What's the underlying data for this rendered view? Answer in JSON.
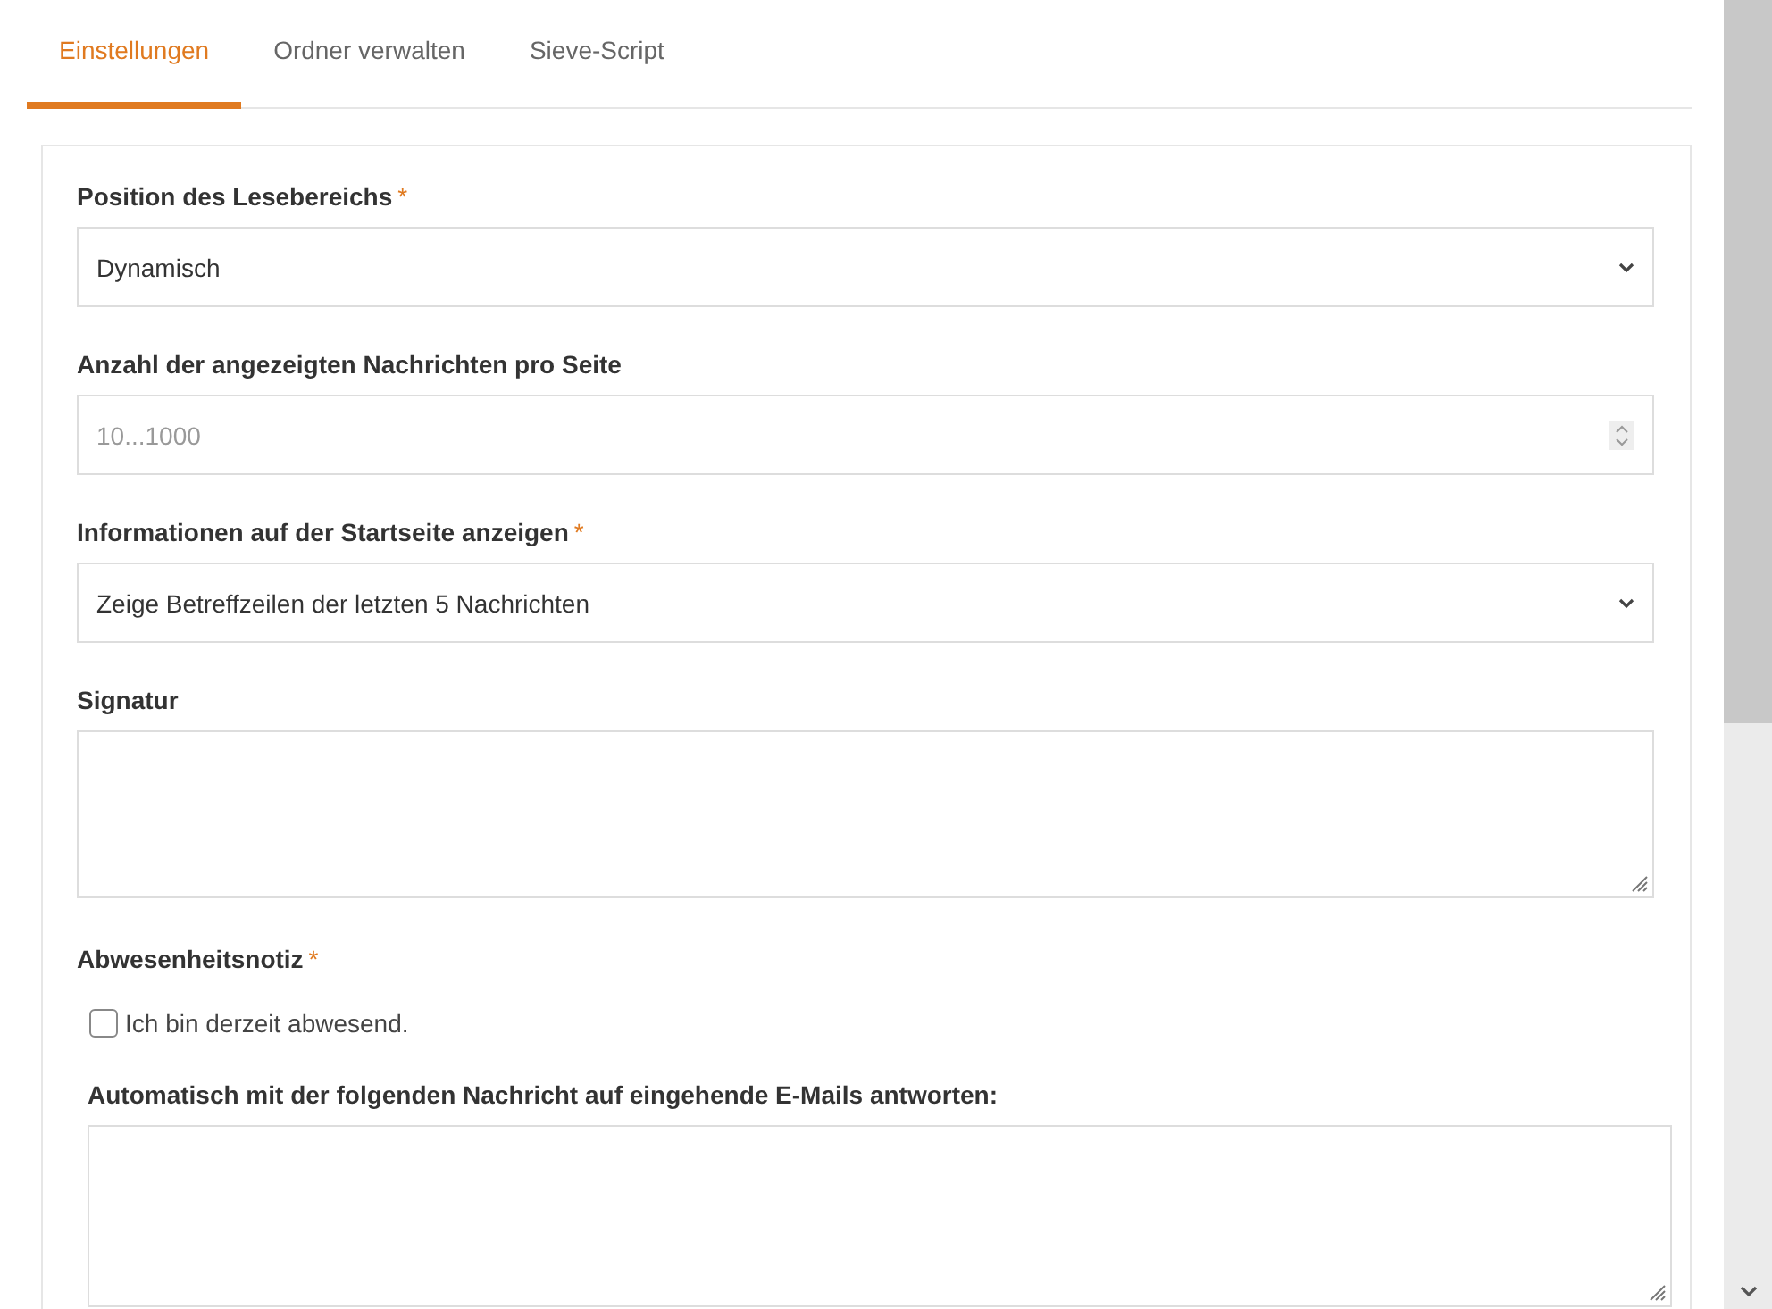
{
  "tabs": [
    {
      "label": "Einstellungen",
      "selected": true
    },
    {
      "label": "Ordner verwalten",
      "selected": false
    },
    {
      "label": "Sieve-Script",
      "selected": false
    }
  ],
  "fields": [
    {
      "kind": "select",
      "label": "Position des Lesebereichs",
      "required": true,
      "value": "Dynamisch"
    },
    {
      "kind": "number",
      "label": "Anzahl der angezeigten Nachrichten pro Seite",
      "required": false,
      "placeholder": "10...1000"
    },
    {
      "kind": "select",
      "label": "Informationen auf der Startseite anzeigen",
      "required": true,
      "value": "Zeige Betreffzeilen der letzten 5 Nachrichten"
    },
    {
      "kind": "textarea",
      "label": "Signatur",
      "required": false
    },
    {
      "kind": "absence",
      "label": "Abwesenheitsnotiz",
      "required": true,
      "checkbox": {
        "label": "Ich bin derzeit abwesend.",
        "checked": false
      },
      "reply_label": "Automatisch mit der folgenden Nachricht auf eingehende E-Mails antworten:"
    }
  ],
  "required_mark": "*"
}
